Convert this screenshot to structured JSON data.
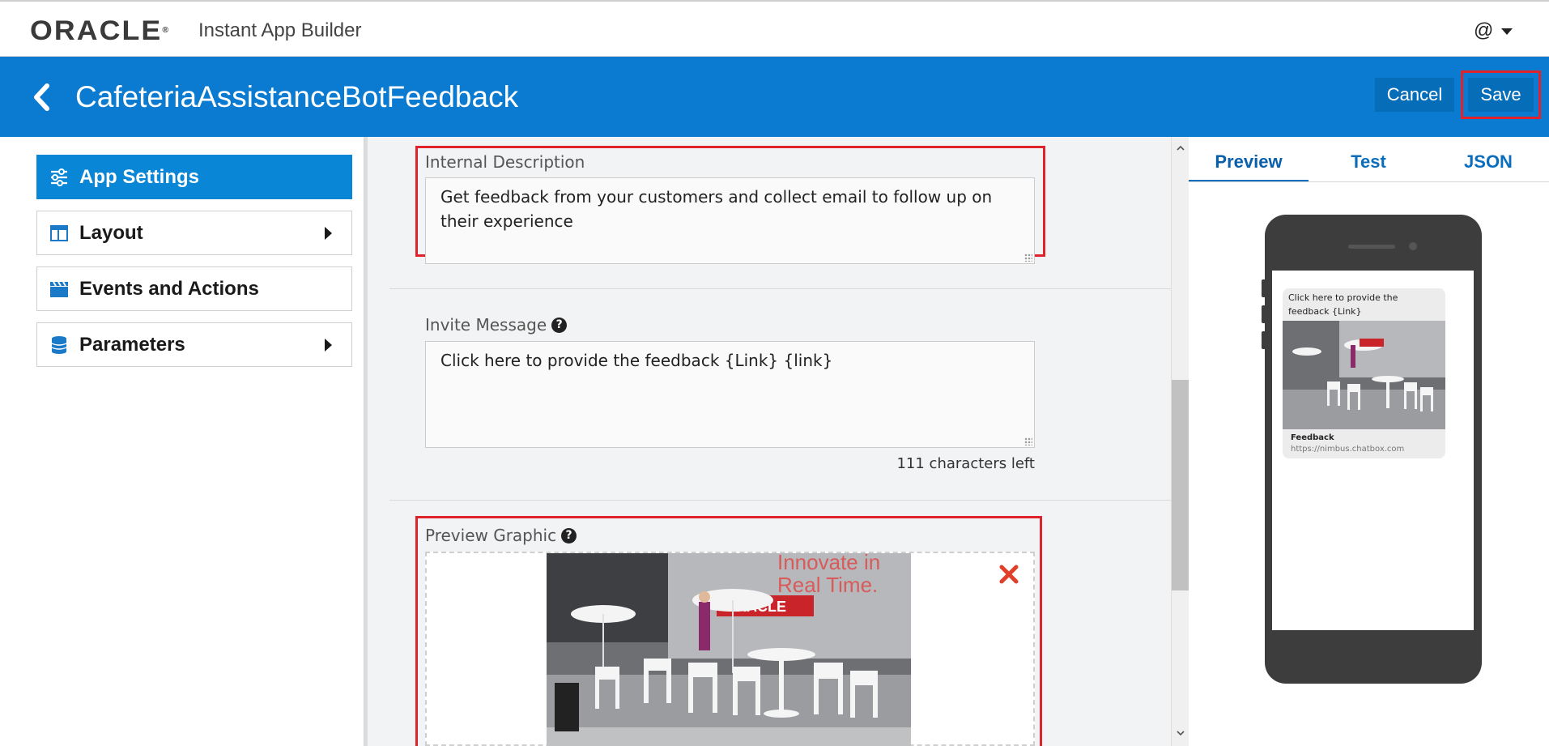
{
  "topbar": {
    "brand": "ORACLE",
    "brand_mark": "®",
    "app_name": "Instant App Builder",
    "user_label": "@"
  },
  "header": {
    "title": "CafeteriaAssistanceBotFeedback",
    "cancel_label": "Cancel",
    "save_label": "Save",
    "color": "#0a7bd1"
  },
  "sidebar": {
    "items": [
      {
        "label": "App Settings",
        "icon": "sliders-icon",
        "active": true,
        "has_submenu": false
      },
      {
        "label": "Layout",
        "icon": "layout-icon",
        "active": false,
        "has_submenu": true
      },
      {
        "label": "Events and Actions",
        "icon": "clapperboard-icon",
        "active": false,
        "has_submenu": false
      },
      {
        "label": "Parameters",
        "icon": "database-icon",
        "active": false,
        "has_submenu": true
      }
    ]
  },
  "main": {
    "internal_description": {
      "label": "Internal Description",
      "value": "Get feedback from your customers and collect email to follow up on their experience"
    },
    "invite_message": {
      "label": "Invite Message",
      "value": "Click here  to provide the feedback {Link} {link}",
      "chars_left": "111 characters left"
    },
    "preview_graphic": {
      "label": "Preview Graphic",
      "image_text_1": "Innovate in",
      "image_text_2": "Real Time.",
      "image_brand": "ORACLE"
    }
  },
  "preview": {
    "tabs": [
      {
        "label": "Preview",
        "active": true
      },
      {
        "label": "Test",
        "active": false
      },
      {
        "label": "JSON",
        "active": false
      }
    ],
    "bubble_text": "Click here to provide the feedback {Link}",
    "card_title": "Feedback",
    "card_url": "https://nimbus.chatbox.com"
  }
}
